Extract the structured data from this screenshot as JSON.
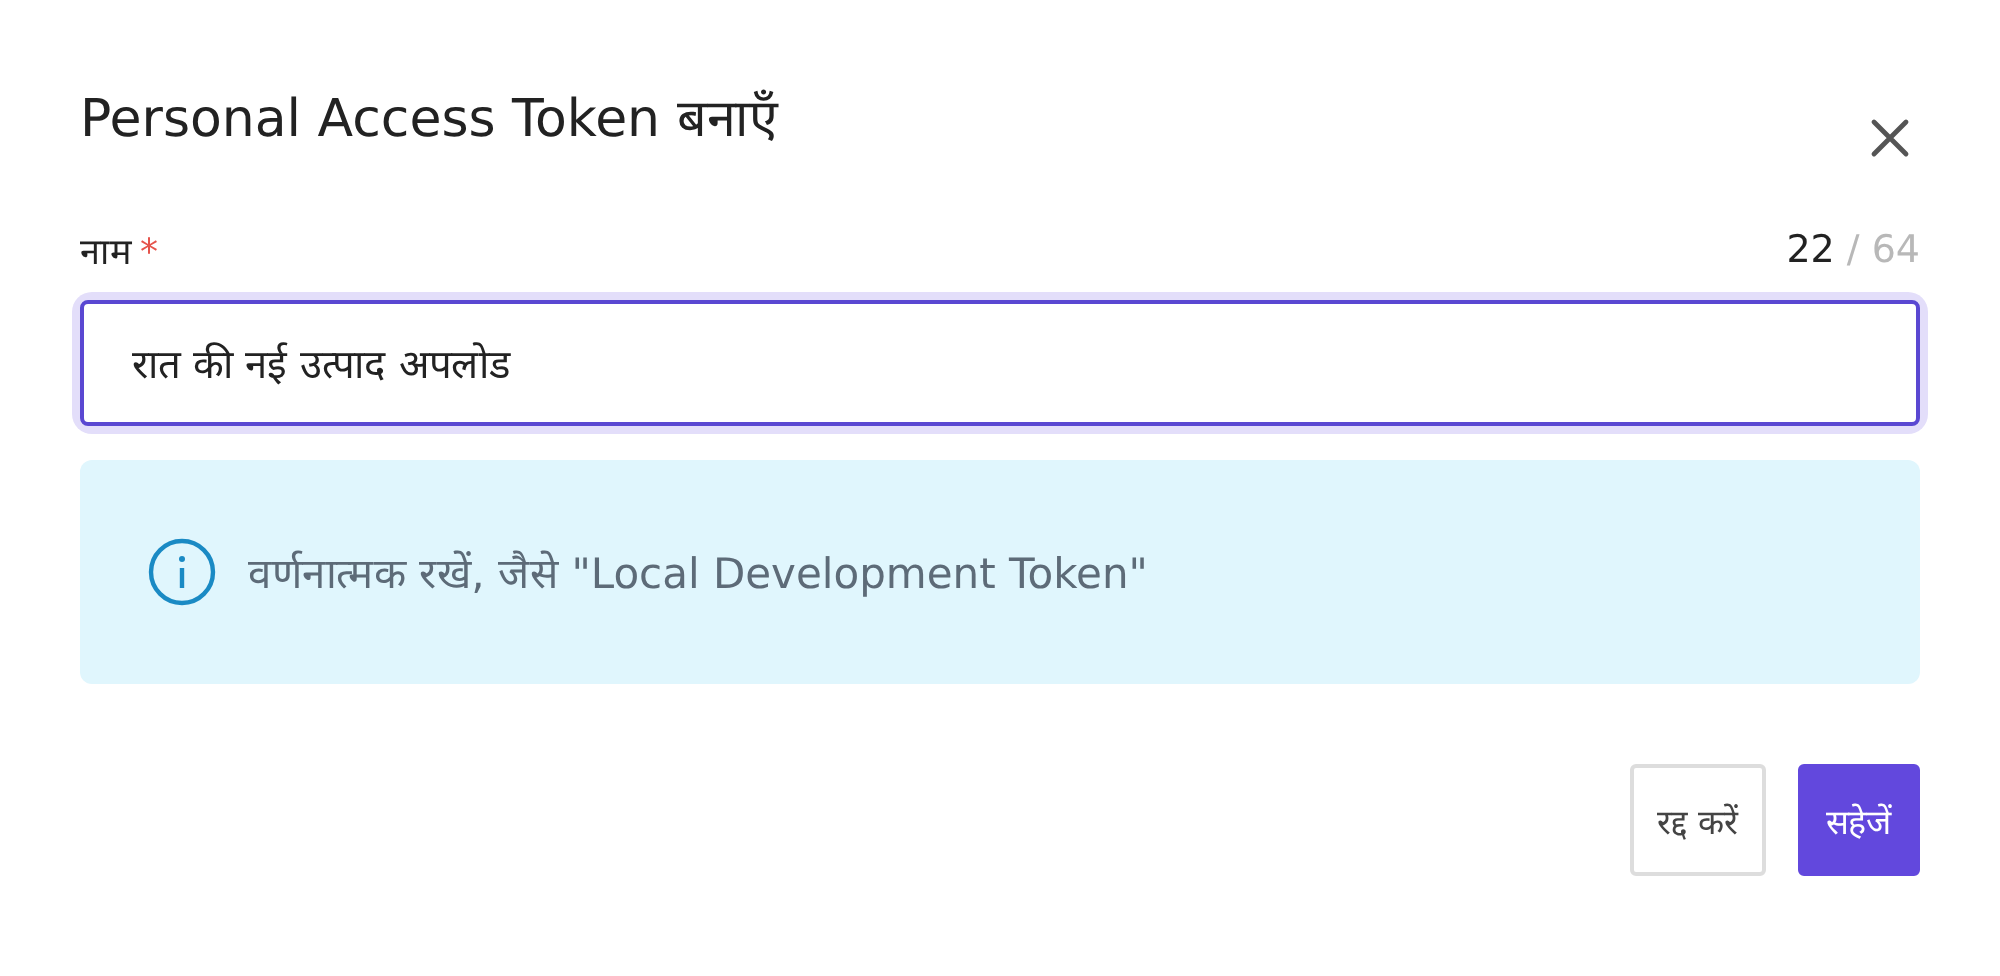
{
  "dialog": {
    "title": "Personal Access Token बनाएँ"
  },
  "name_field": {
    "label": "नाम",
    "required_mark": "*",
    "count": "22",
    "separator": "/",
    "max": "64",
    "value": "रात की नई उत्पाद अपलोड",
    "focused": true
  },
  "info": {
    "text": "वर्णनात्मक रखें, जैसे \"Local Development Token\""
  },
  "buttons": [
    {
      "label": "रद्द करें",
      "kind": "secondary"
    },
    {
      "label": "सहेजें",
      "kind": "primary"
    }
  ]
}
